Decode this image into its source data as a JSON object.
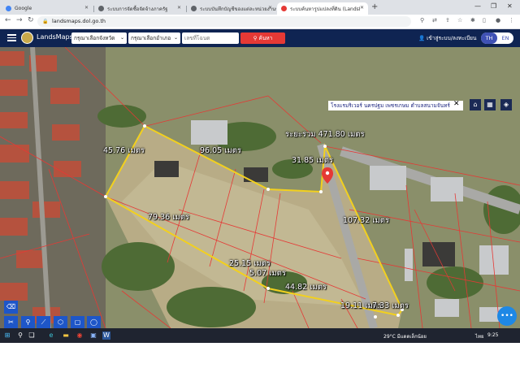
{
  "browser": {
    "tabs": [
      {
        "title": "Google",
        "favicon_color": "#4285f4",
        "active": false
      },
      {
        "title": "ระบบการจัดซื้อจัดจ้างภาครัฐ",
        "favicon_color": "#5f6368",
        "active": false
      },
      {
        "title": "ระบบบันทึกบัญชีของแต่ละหน่วยงานของรัฐ",
        "favicon_color": "#5f6368",
        "active": false
      },
      {
        "title": "ระบบค้นหารูปแปลงที่ดิน (LandsMaps)",
        "favicon_color": "#e53935",
        "active": true
      }
    ],
    "new_tab": "+",
    "url": "landsmaps.dol.go.th"
  },
  "header": {
    "brand": "LandsMaps",
    "province_select": "กรุณาเลือกจังหวัด",
    "district_select": "กรุณาเลือกอำเภอ",
    "parcel_placeholder": "เลขที่โฉนด",
    "search_label": "ค้นหา",
    "login_label": "เข้าสู่ระบบ/ลงทะเบียน",
    "lang_th": "TH",
    "lang_en": "EN"
  },
  "map": {
    "location_text": "โรงแรมริเวอร์ นครปฐม เพชรเกษม ตำบลสนามจันทร์",
    "total_label": "ระยะรวม 471.80 เมตร",
    "measurements": [
      "45.76 เมตร",
      "96.05 เมตร",
      "31.85 เมตร",
      "107.32 เมตร",
      "79.36 เมตร",
      "25.15 เมตร",
      "5.07 เมตร",
      "44.82 เมตร",
      "19.11 เมตร",
      "7.33 เมตร"
    ],
    "polygon_color": "#f2d01e",
    "parcel_line_color": "#e53935"
  },
  "taskbar": {
    "weather": "29°C  มีแดดเล็กน้อย",
    "lang": "ไทย",
    "time": "9:25"
  }
}
